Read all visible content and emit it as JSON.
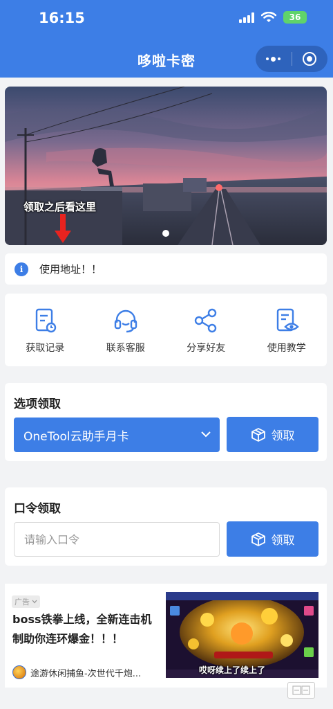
{
  "status_bar": {
    "time": "16:15",
    "battery": "36"
  },
  "nav": {
    "title": "哆啦卡密"
  },
  "banner": {
    "caption": "领取之后看这里"
  },
  "notice": {
    "text": "使用地址！！"
  },
  "actions": [
    {
      "label": "获取记录",
      "icon": "record-icon"
    },
    {
      "label": "联系客服",
      "icon": "headset-icon"
    },
    {
      "label": "分享好友",
      "icon": "share-icon"
    },
    {
      "label": "使用教学",
      "icon": "tutorial-icon"
    }
  ],
  "option_claim": {
    "title": "选项领取",
    "selected_option": "OneTool云助手月卡",
    "button_label": "领取"
  },
  "code_claim": {
    "title": "口令领取",
    "placeholder": "请输入口令",
    "button_label": "领取"
  },
  "ad": {
    "badge": "广告",
    "headline": "boss铁拳上线，全新连击机制助你连环爆金！！！",
    "source": "途游休闲捕鱼-次世代千炮...",
    "image_caption": "哎呀续上了续上了"
  },
  "colors": {
    "accent": "#3d7ee6",
    "background": "#f2f3f5"
  }
}
